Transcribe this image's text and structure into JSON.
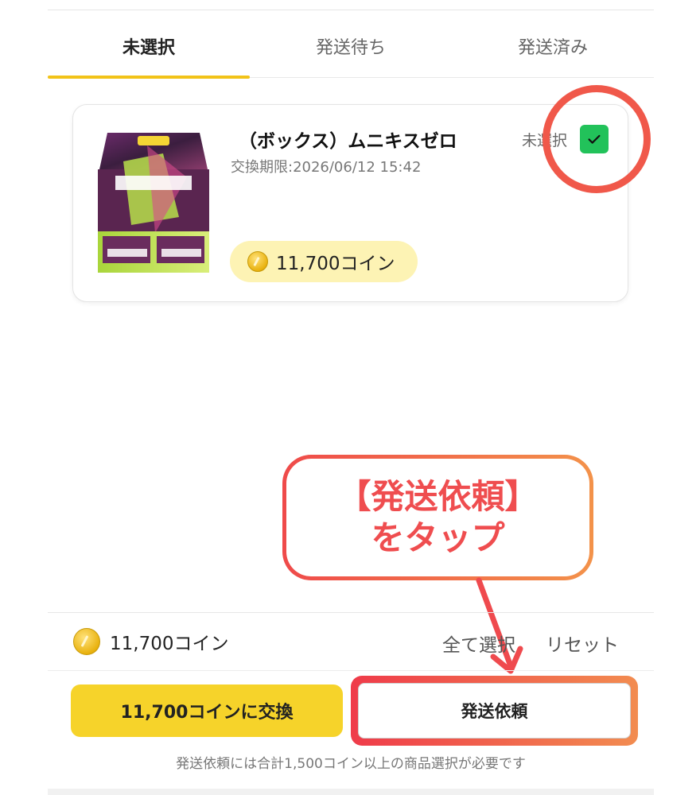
{
  "tabs": [
    {
      "label": "未選択",
      "active": true
    },
    {
      "label": "発送待ち",
      "active": false
    },
    {
      "label": "発送済み",
      "active": false
    }
  ],
  "item": {
    "title": "（ボックス）ムニキスゼロ",
    "deadline": "交換期限:2026/06/12 15:42",
    "coins": "11,700コイン",
    "select_label": "未選択",
    "checked": true
  },
  "callout": {
    "line1": "【発送依頼】",
    "line2": "をタップ"
  },
  "bottom": {
    "total_coins": "11,700コイン",
    "select_all": "全て選択",
    "reset": "リセット",
    "exchange_button": "11,700コインに交換",
    "ship_button": "発送依頼",
    "note": "発送依頼には合計1,500コイン以上の商品選択が必要です"
  },
  "colors": {
    "accent": "#f2c318",
    "checkbox": "#22c25a",
    "annotation": "#f0584a",
    "coin_pill": "#fdf3b4"
  }
}
